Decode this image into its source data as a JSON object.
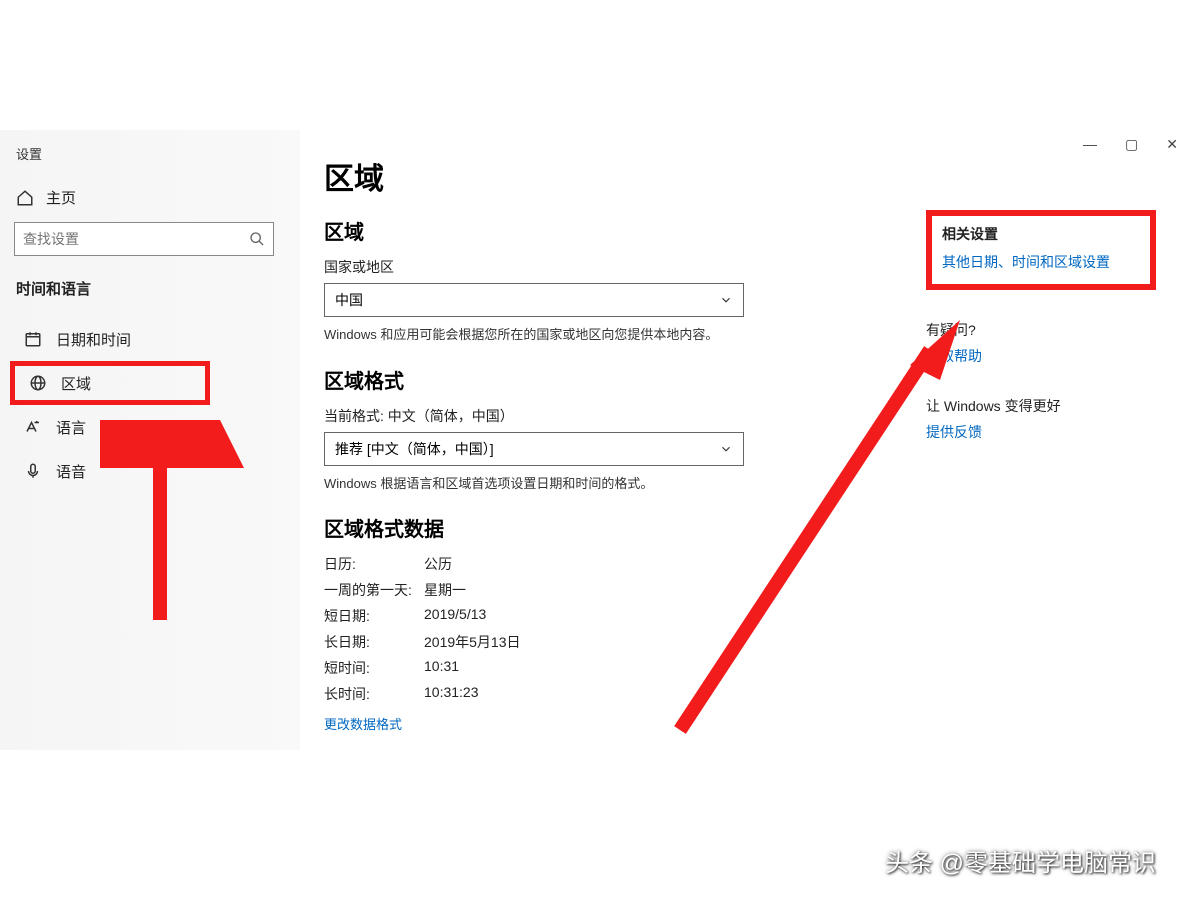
{
  "window": {
    "title": "设置",
    "controls": {
      "min": "—",
      "max": "▢",
      "close": "✕"
    }
  },
  "sidebar": {
    "home": "主页",
    "search_placeholder": "查找设置",
    "section": "时间和语言",
    "items": [
      {
        "icon": "calendar",
        "label": "日期和时间"
      },
      {
        "icon": "globe",
        "label": "区域"
      },
      {
        "icon": "language",
        "label": "语言"
      },
      {
        "icon": "mic",
        "label": "语音"
      }
    ]
  },
  "main": {
    "title": "区域",
    "region": {
      "heading": "区域",
      "country_label": "国家或地区",
      "country_value": "中国",
      "country_desc": "Windows 和应用可能会根据您所在的国家或地区向您提供本地内容。"
    },
    "format": {
      "heading": "区域格式",
      "current_label": "当前格式: 中文（简体，中国）",
      "recommend_value": "推荐 [中文（简体，中国）]",
      "desc": "Windows 根据语言和区域首选项设置日期和时间的格式。"
    },
    "data": {
      "heading": "区域格式数据",
      "rows": [
        {
          "k": "日历:",
          "v": "公历"
        },
        {
          "k": "一周的第一天:",
          "v": "星期一"
        },
        {
          "k": "短日期:",
          "v": "2019/5/13"
        },
        {
          "k": "长日期:",
          "v": "2019年5月13日"
        },
        {
          "k": "短时间:",
          "v": "10:31"
        },
        {
          "k": "长时间:",
          "v": "10:31:23"
        }
      ]
    },
    "change_link": "更改数据格式"
  },
  "right": {
    "related_heading": "相关设置",
    "related_link": "其他日期、时间和区域设置",
    "help_heading": "有疑问?",
    "help_link": "获取帮助",
    "feedback_heading": "让 Windows 变得更好",
    "feedback_link": "提供反馈"
  },
  "watermark": "头条 @零基础学电脑常识"
}
